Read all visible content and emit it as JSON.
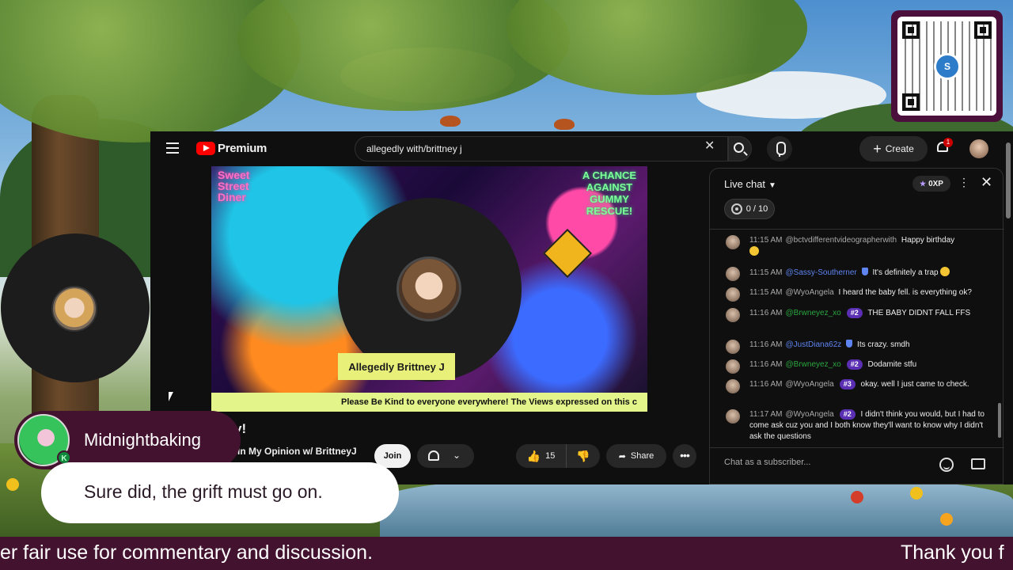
{
  "browser": {
    "logo_text": "Premium",
    "search_value": "allegedly with/brittney j",
    "create_label": "Create",
    "notification_count": "1"
  },
  "video": {
    "thumb_text_left": "Sweet Street Diner",
    "thumb_text_right": "A CHANCE AGAINST GUMMY RESCUE!",
    "participant_name": "Allegedly Brittney J",
    "ticker": "Please Be Kind to everyone everywhere! The Views expressed on this c",
    "title_visible": "y!",
    "channel_visible": "In My Opinion w/ BrittneyJ",
    "join_label": "Join",
    "like_count": "15",
    "share_label": "Share"
  },
  "chat": {
    "title": "Live chat",
    "xp_label": "0XP",
    "goal_label": "0 / 10",
    "input_placeholder": "Chat as a subscriber...",
    "messages": [
      {
        "time": "11:15 AM",
        "author": "@bctvdifferentvideographerwith",
        "text": "Happy birthday"
      },
      {
        "time": "11:15 AM",
        "author": "@Sassy-Southerner",
        "text": "It's definitely a trap"
      },
      {
        "time": "11:15 AM",
        "author": "@WyoAngela",
        "text": "I heard the baby fell. is everything ok?"
      },
      {
        "time": "11:16 AM",
        "author": "@Brwneyez_xo",
        "rank": "#2",
        "text": "THE BABY DIDNT FALL FFS"
      },
      {
        "time": "11:16 AM",
        "author": "@JustDiana62z",
        "text": "Its crazy. smdh"
      },
      {
        "time": "11:16 AM",
        "author": "@Brwneyez_xo",
        "rank": "#2",
        "text": "Dodamite stfu"
      },
      {
        "time": "11:16 AM",
        "author": "@WyoAngela",
        "rank": "#3",
        "text": "okay. well I just came to check."
      },
      {
        "time": "11:17 AM",
        "author": "@WyoAngela",
        "rank": "#2",
        "text": "I didn't think you would, but I had to come ask cuz you and I both know they'll want to know why I didn't ask the questions"
      }
    ]
  },
  "overlay": {
    "chat_name": "Midnightbaking",
    "chat_badge": "K",
    "chat_message": "Sure did, the grift must go on.",
    "banner_left": "er fair use for commentary and discussion.",
    "banner_right": "Thank you f"
  },
  "colors": {
    "brand_red": "#ff0000",
    "overlay_purple": "#43122f",
    "member_green": "#2ba640",
    "rank_purple": "#5a2fb3"
  }
}
